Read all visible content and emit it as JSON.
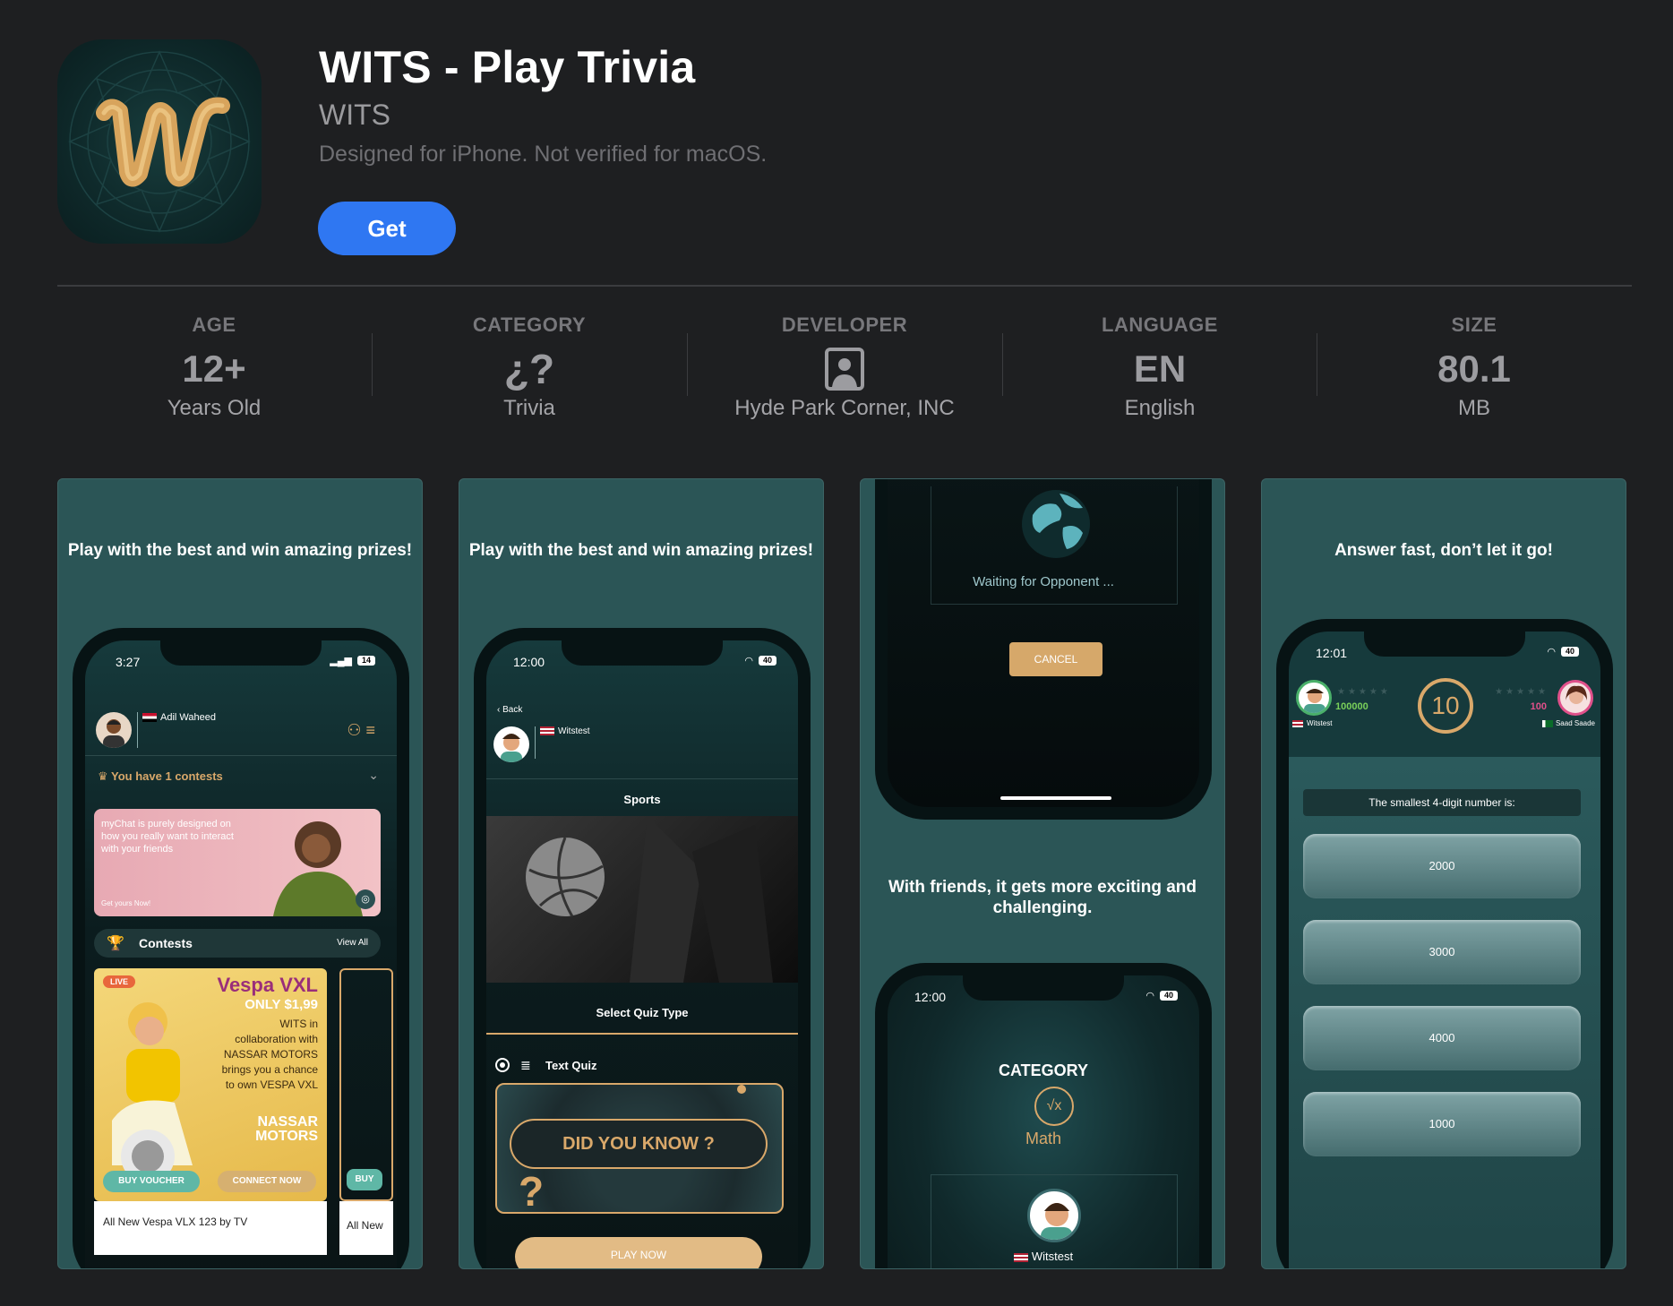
{
  "app": {
    "title": "WITS - Play Trivia",
    "developer": "WITS",
    "compat": "Designed for iPhone. Not verified for macOS.",
    "get_label": "Get"
  },
  "info": [
    {
      "label": "AGE",
      "value": "12+",
      "sub": "Years Old"
    },
    {
      "label": "CATEGORY",
      "value": "¿?",
      "sub": "Trivia"
    },
    {
      "label": "DEVELOPER",
      "value": "",
      "sub": "Hyde Park Corner, INC"
    },
    {
      "label": "LANGUAGE",
      "value": "EN",
      "sub": "English"
    },
    {
      "label": "SIZE",
      "value": "80.1",
      "sub": "MB"
    }
  ],
  "shots": {
    "s1": {
      "tagline": "Play with the best and win amazing prizes!",
      "time": "3:27",
      "battery": "14",
      "user": "Adil Waheed",
      "contests_msg": "You have 1 contests",
      "banner_text": "myChat is purely designed on how you really want to interact with your friends",
      "banner_cta": "Get yours Now!",
      "contests_title": "Contests",
      "view_all": "View All",
      "live": "LIVE",
      "promo_title": "Vespa VXL",
      "promo_price": "ONLY $1,99",
      "promo_body": "WITS in collaboration with NASSAR MOTORS brings you a chance to own VESPA VXL",
      "promo_brand": "NASSAR MOTORS",
      "buy_voucher": "BUY VOUCHER",
      "connect_now": "CONNECT NOW",
      "buy_short": "BUY",
      "caption": "All New Vespa VLX 123 by TV",
      "caption2": "All New"
    },
    "s2": {
      "tagline": "Play with the best and win amazing prizes!",
      "time": "12:00",
      "battery": "40",
      "back": "Back",
      "user": "Witstest",
      "topic": "Sports",
      "select_type": "Select Quiz Type",
      "option": "Text Quiz",
      "did_you_know": "DID YOU KNOW ?",
      "play_now": "PLAY NOW"
    },
    "s3": {
      "waiting": "Waiting for Opponent ...",
      "cancel": "CANCEL",
      "tagline": "With friends, it gets more exciting and challenging.",
      "time": "12:00",
      "battery": "40",
      "category": "CATEGORY",
      "math": "Math",
      "user": "Witstest"
    },
    "s4": {
      "tagline": "Answer fast, don’t let it go!",
      "time": "12:01",
      "battery": "40",
      "p1_score": "100000",
      "p1_name": "Witstest",
      "timer": "10",
      "p2_score": "100",
      "p2_name": "Saad Saade",
      "question": "The smallest 4-digit number is:",
      "answers": [
        "2000",
        "3000",
        "4000",
        "1000"
      ]
    }
  }
}
